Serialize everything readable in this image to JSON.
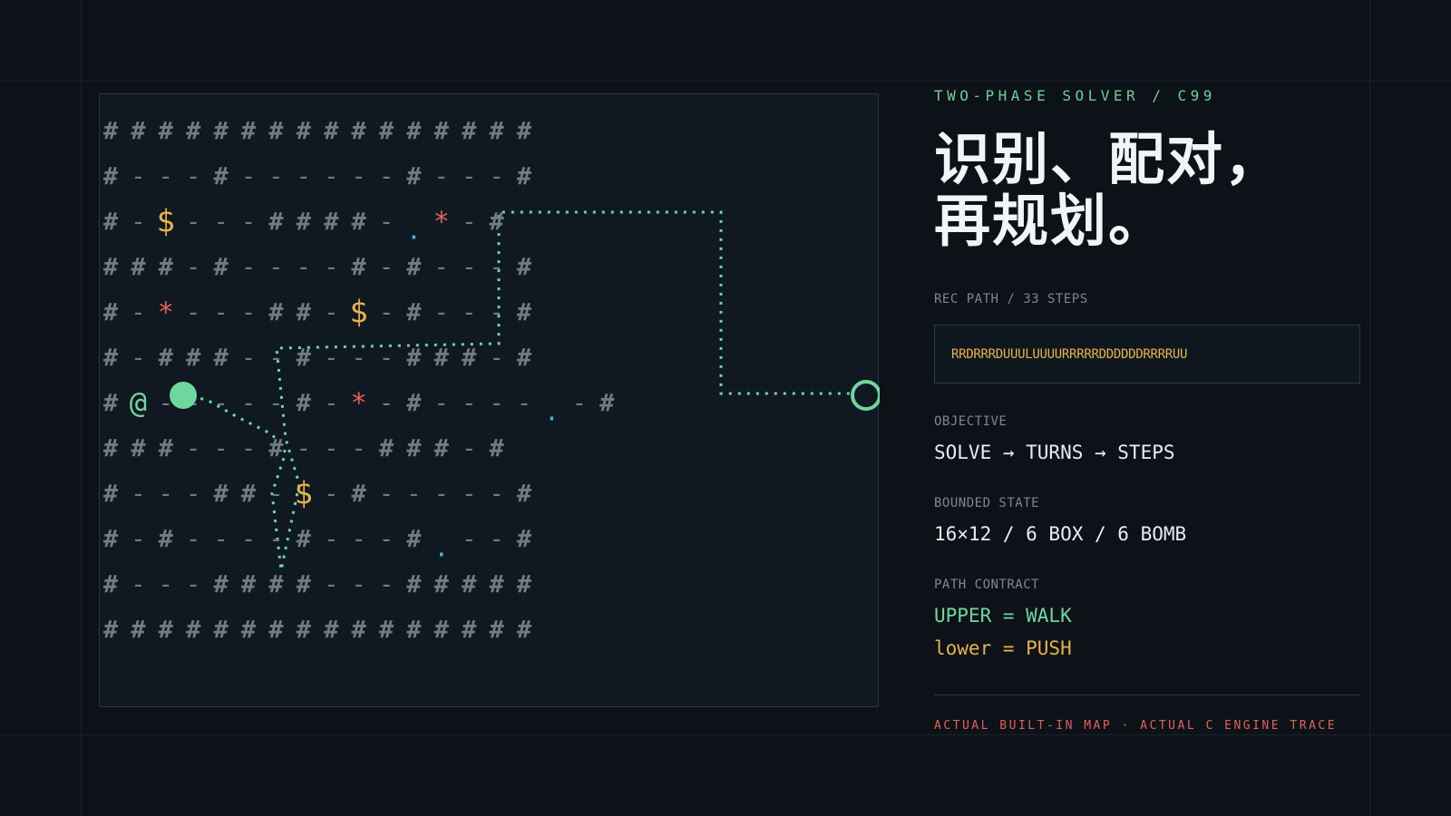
{
  "map": {
    "grid": [
      "################",
      "#---#------#---#",
      "#-$---####-.*-#",
      "###-#----#-#---#",
      "#-*---##-$-#---#",
      "#-###--#---###-#",
      "#@-----#-*-#----.-#",
      "###---#---###-#",
      "#---##-$-#-----#",
      "#-#----#---#.--#",
      "#---####---#####",
      "################"
    ],
    "legend": {
      "wall": "#",
      "floor": "-",
      "box": "$",
      "bomb": "*",
      "player": "@",
      "target": "."
    },
    "colors": {
      "wall": "#6f7b85",
      "box": "#e7b24a",
      "bomb": "#e0625a",
      "player": "#6fd6a0",
      "target": "#4fb3d8",
      "path": "#6fd6a0"
    }
  },
  "info": {
    "kicker": "TWO-PHASE SOLVER / C99",
    "title_line1": "识别、配对，",
    "title_line2": "再规划。",
    "rec_path_label": "REC PATH / 33 STEPS",
    "rec_path": "RRDRRRDUUULUUUURRRRRDDDDDDRRRRUU",
    "objective_label": "OBJECTIVE",
    "objective": "SOLVE → TURNS → STEPS",
    "bounded_label": "BOUNDED STATE",
    "bounded": "16×12 / 6 BOX / 6 BOMB",
    "contract_label": "PATH CONTRACT",
    "contract_walk": "UPPER = WALK",
    "contract_push": "lower = PUSH",
    "footer": "ACTUAL BUILT-IN MAP · ACTUAL C ENGINE TRACE"
  }
}
